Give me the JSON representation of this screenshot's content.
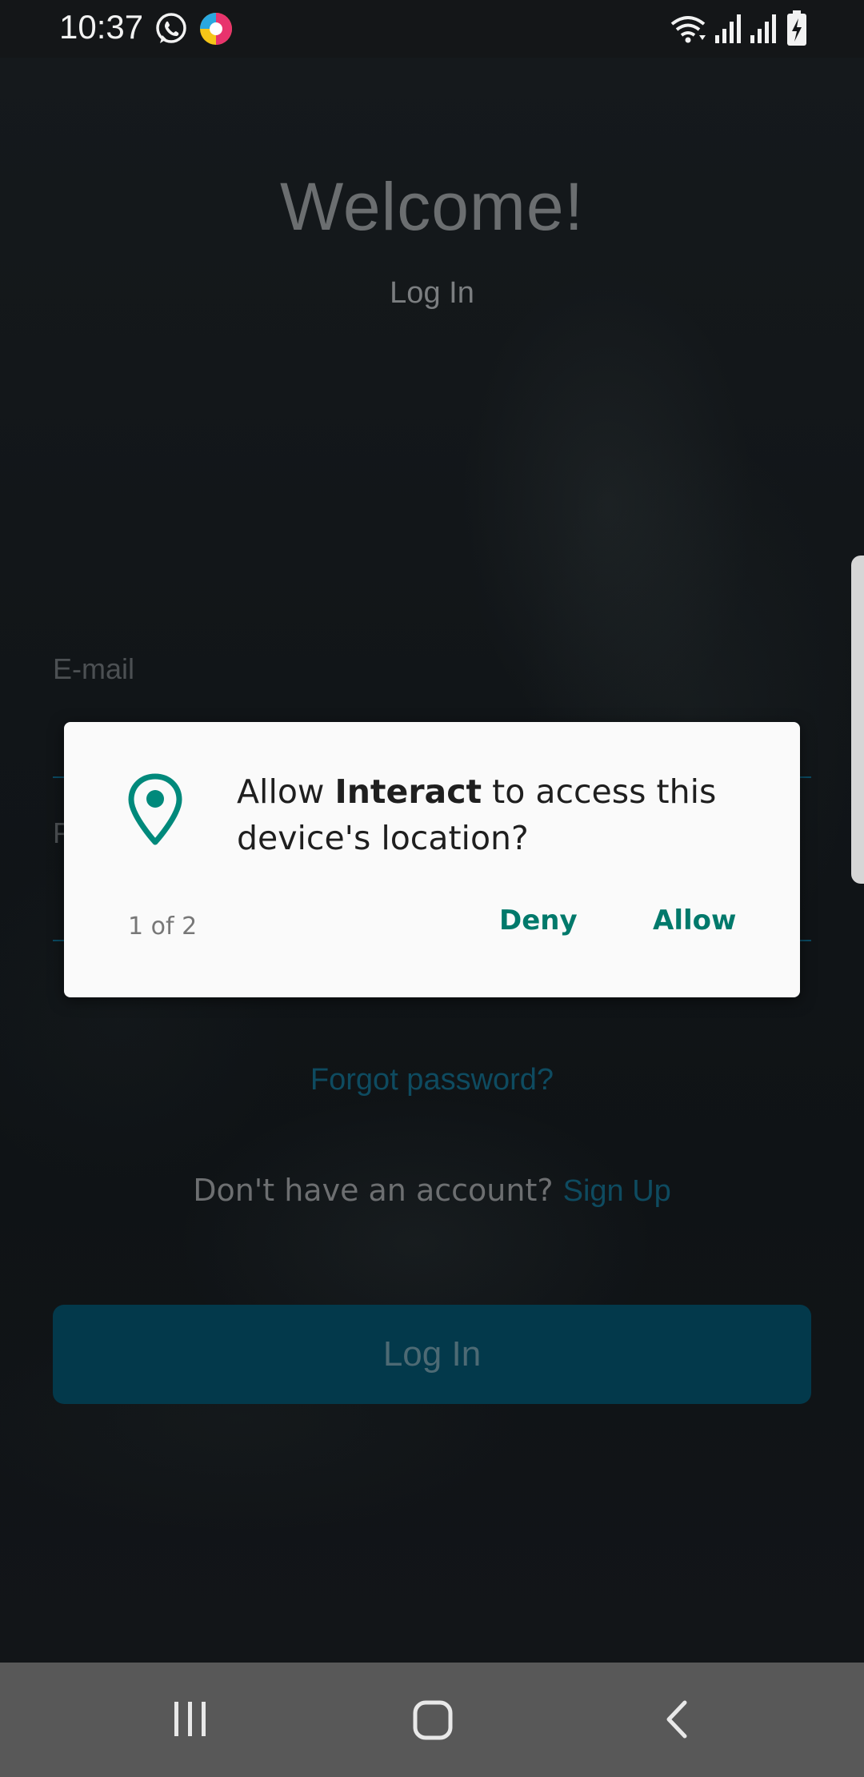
{
  "status_bar": {
    "time": "10:37",
    "icons": [
      "whatsapp-icon",
      "app-notification-icon",
      "wifi-icon",
      "signal-icon",
      "signal-icon",
      "battery-charging-icon"
    ]
  },
  "login": {
    "title": "Welcome!",
    "subtitle": "Log In",
    "email_label": "E-mail",
    "password_label_partial": "P",
    "forgot_password": "Forgot password?",
    "signup_prompt": "Don't have an account? ",
    "signup_link": "Sign Up",
    "login_button": "Log In"
  },
  "dialog": {
    "icon": "location-pin-icon",
    "message_prefix": "Allow ",
    "app_name": "Interact",
    "message_suffix": " to access this device's location?",
    "counter": "1 of 2",
    "deny_label": "Deny",
    "allow_label": "Allow"
  },
  "nav_bar": {
    "buttons": [
      "recent-apps-icon",
      "home-icon",
      "back-icon"
    ]
  },
  "colors": {
    "accent": "#00796b",
    "dialog_background": "#fafafa",
    "login_button": "#03394b"
  }
}
